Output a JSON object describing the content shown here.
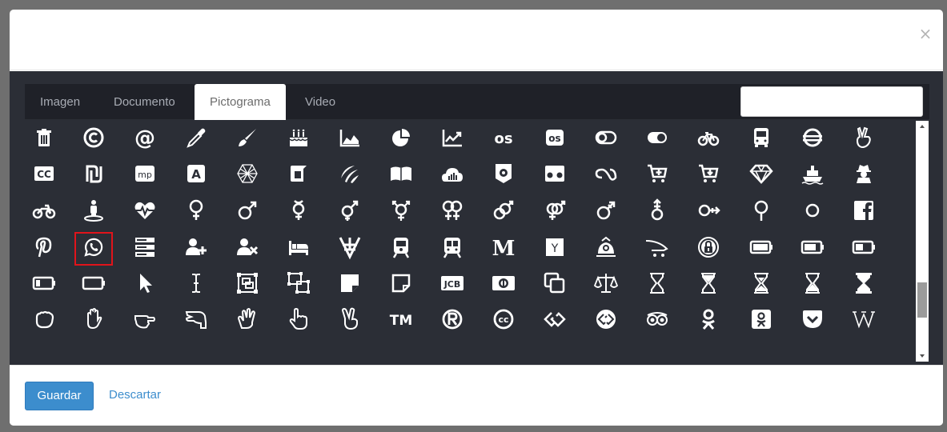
{
  "dialog": {
    "close_label": "×"
  },
  "tabs": [
    {
      "label": "Imagen"
    },
    {
      "label": "Documento"
    },
    {
      "label": "Pictograma"
    },
    {
      "label": "Video"
    }
  ],
  "search": {
    "value": "",
    "placeholder": ""
  },
  "footer": {
    "save_label": "Guardar",
    "discard_label": "Descartar"
  },
  "icons": [
    [
      "trash-icon",
      "copyright-icon",
      "at-icon",
      "eyedropper-icon",
      "paint-brush-icon",
      "birthday-cake-icon",
      "area-chart-icon",
      "pie-chart-icon",
      "line-chart-icon",
      "lastfm-icon",
      "lastfm-square-icon",
      "toggle-off-icon",
      "toggle-on-icon",
      "bicycle-icon",
      "bus-icon",
      "ioxhost-icon",
      "angellist-icon"
    ],
    [
      "cc-icon",
      "shekel-icon",
      "meanpath-icon",
      "buysellads-icon",
      "connectdevelop-icon",
      "dashcube-icon",
      "forumbee-icon",
      "leanpub-icon",
      "sellsy-icon",
      "shirtsinbulk-icon",
      "simplybuilt-icon",
      "skyatlas-icon",
      "cart-plus-icon",
      "cart-arrow-down-icon",
      "diamond-icon",
      "ship-icon",
      "user-secret-icon"
    ],
    [
      "motorcycle-icon",
      "street-view-icon",
      "heartbeat-icon",
      "venus-icon",
      "mars-icon",
      "mercury-icon",
      "transgender-icon",
      "transgender-alt-icon",
      "venus-double-icon",
      "mars-double-icon",
      "venus-mars-icon",
      "mars-stroke-icon",
      "mars-stroke-v-icon",
      "mars-stroke-h-icon",
      "neuter-icon",
      "genderless-icon",
      "facebook-official-icon"
    ],
    [
      "pinterest-p-icon",
      "whatsapp-icon",
      "server-icon",
      "user-plus-icon",
      "user-times-icon",
      "bed-icon",
      "viacoin-icon",
      "train-icon",
      "subway-icon",
      "medium-icon",
      "y-combinator-icon",
      "optin-monster-icon",
      "opencart-icon",
      "expeditedssl-icon",
      "battery-full-icon",
      "battery-three-quarters-icon",
      "battery-half-icon"
    ],
    [
      "battery-quarter-icon",
      "battery-empty-icon",
      "mouse-pointer-icon",
      "i-cursor-icon",
      "object-group-icon",
      "object-ungroup-icon",
      "sticky-note-icon",
      "sticky-note-o-icon",
      "cc-jcb-icon",
      "cc-diners-club-icon",
      "clone-icon",
      "balance-scale-icon",
      "hourglass-o-icon",
      "hourglass-start-icon",
      "hourglass-half-icon",
      "hourglass-end-icon",
      "hourglass-icon"
    ],
    [
      "hand-rock-icon",
      "hand-paper-icon",
      "hand-scissors-icon",
      "hand-lizard-icon",
      "hand-spock-icon",
      "hand-pointer-icon",
      "hand-peace-icon",
      "trademark-icon",
      "registered-icon",
      "creative-commons-icon",
      "gg-icon",
      "gg-circle-icon",
      "tripadvisor-icon",
      "odnoklassniki-icon",
      "odnoklassniki-square-icon",
      "get-pocket-icon",
      "wikipedia-w-icon"
    ]
  ],
  "selected_icon": "whatsapp-icon",
  "colors": {
    "panel_bg": "#2b2e36",
    "tab_strip_bg": "#1f2128",
    "icon_color": "#ffffff",
    "selection_border": "#e0141b",
    "primary_button": "#3c8dcd"
  },
  "scroll": {
    "position_fraction": 0.72
  }
}
